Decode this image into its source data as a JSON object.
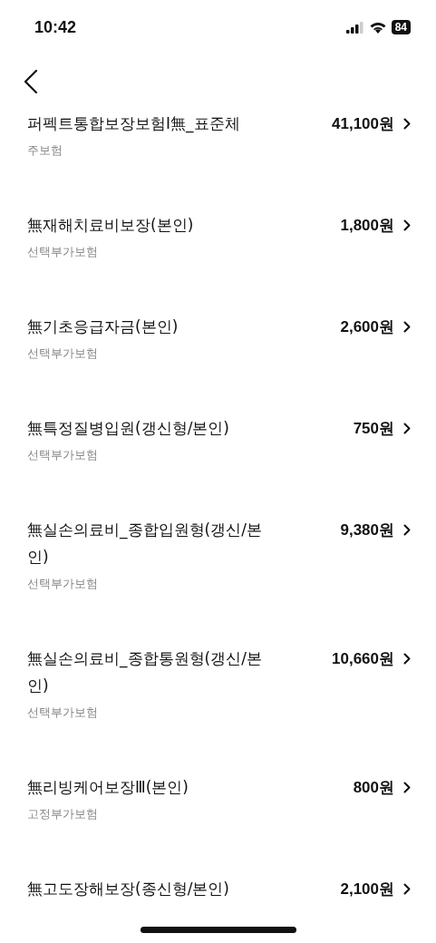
{
  "status_bar": {
    "time": "10:42",
    "battery": "84"
  },
  "items": [
    {
      "name": "퍼펙트통합보장보험I無_표준체",
      "price": "41,100원",
      "category": "주보험"
    },
    {
      "name": "無재해치료비보장(본인)",
      "price": "1,800원",
      "category": "선택부가보험"
    },
    {
      "name": "無기초응급자금(본인)",
      "price": "2,600원",
      "category": "선택부가보험"
    },
    {
      "name": "無특정질병입원(갱신형/본인)",
      "price": "750원",
      "category": "선택부가보험"
    },
    {
      "name": "無실손의료비_종합입원형(갱신/본인)",
      "price": "9,380원",
      "category": "선택부가보험"
    },
    {
      "name": "無실손의료비_종합통원형(갱신/본인)",
      "price": "10,660원",
      "category": "선택부가보험"
    },
    {
      "name": "無리빙케어보장Ⅲ(본인)",
      "price": "800원",
      "category": "고정부가보험"
    },
    {
      "name": "無고도장해보장(종신형/본인)",
      "price": "2,100원"
    }
  ]
}
